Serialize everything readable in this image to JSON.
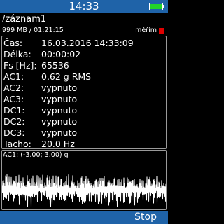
{
  "status_bar": {
    "time": "14:33"
  },
  "header": {
    "path": "/záznam1",
    "memory": "999 MB / 01:21:15",
    "recording_label": "měřím",
    "recording_color": "#e00000"
  },
  "info": {
    "rows": [
      {
        "key": "Čas:",
        "value": "16.03.2016 14:33:09"
      },
      {
        "key": "Délka:",
        "value": "00:00:02"
      },
      {
        "key": "Fs [Hz]:",
        "value": "65536"
      },
      {
        "key": "AC1:",
        "value": "0.62 g RMS"
      },
      {
        "key": "AC2:",
        "value": "vypnuto"
      },
      {
        "key": "AC3:",
        "value": "vypnuto"
      },
      {
        "key": "DC1:",
        "value": "vypnuto"
      },
      {
        "key": "DC2:",
        "value": "vypnuto"
      },
      {
        "key": "DC3:",
        "value": "vypnuto"
      },
      {
        "key": "Tacho:",
        "value": "20.0 Hz"
      }
    ]
  },
  "chart": {
    "label": "AC1: (-3.00; 3.00) g"
  },
  "chart_data": {
    "type": "line",
    "series_color": "#ffffff",
    "ylim": [
      -3.0,
      3.0
    ],
    "signal_rms": 0.62,
    "grid": false
  },
  "bottom_bar": {
    "stop_label": "Stop"
  },
  "colors": {
    "bar": "#1f63a8",
    "background": "#000000",
    "battery": "#22d32a"
  }
}
